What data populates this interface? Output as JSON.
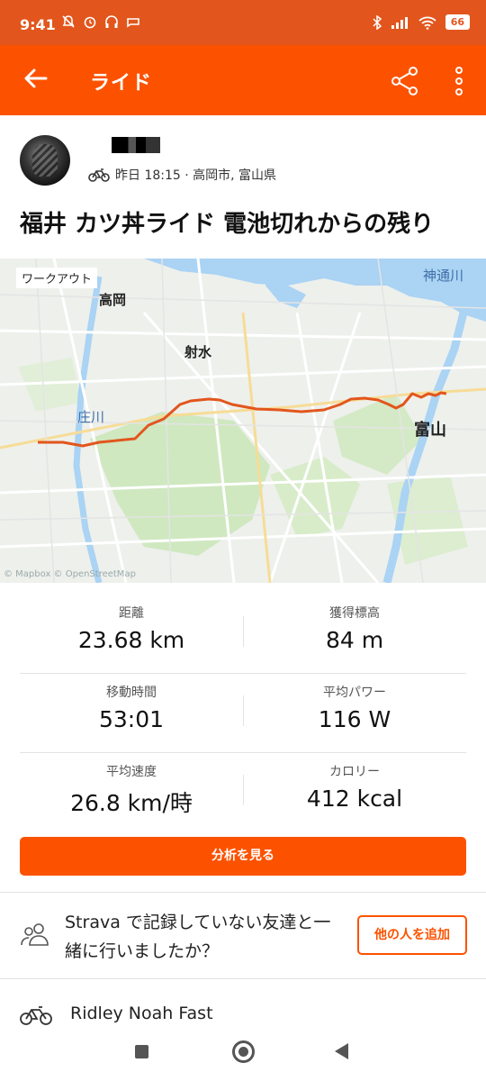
{
  "status_bar": {
    "time": "9:41",
    "battery": "66",
    "left_icons": [
      "notifications-off-icon",
      "alarm-icon",
      "headphones-icon",
      "message-icon"
    ],
    "right_icons": [
      "bluetooth-icon",
      "signal-icon",
      "wifi-icon",
      "battery-icon"
    ]
  },
  "app_bar": {
    "title": "ライド",
    "accent_color": "#fc5200"
  },
  "athlete": {
    "meta": "昨日 18:15 · 高岡市, 富山県"
  },
  "activity": {
    "title": "福井 カツ丼ライド 電池切れからの残り"
  },
  "map": {
    "badge": "ワークアウト",
    "labels": {
      "takaoka": "高岡",
      "imizu": "射水",
      "shogawa": "庄川",
      "jinzugawa": "神通川",
      "toyama": "富山"
    },
    "attribution": "© Mapbox © OpenStreetMap"
  },
  "stats": [
    {
      "left": {
        "label": "距離",
        "value": "23.68 km"
      },
      "right": {
        "label": "獲得標高",
        "value": "84 m"
      }
    },
    {
      "left": {
        "label": "移動時間",
        "value": "53:01"
      },
      "right": {
        "label": "平均パワー",
        "value": "116 W"
      }
    },
    {
      "left": {
        "label": "平均速度",
        "value": "26.8 km/時"
      },
      "right": {
        "label": "カロリー",
        "value": "412 kcal"
      }
    }
  ],
  "analyze_button": "分析を見る",
  "invite": {
    "text": "Strava で記録していない友達と一緒に行いましたか？",
    "button": "他の人を追加"
  },
  "gear": {
    "name": "Ridley Noah Fast"
  }
}
